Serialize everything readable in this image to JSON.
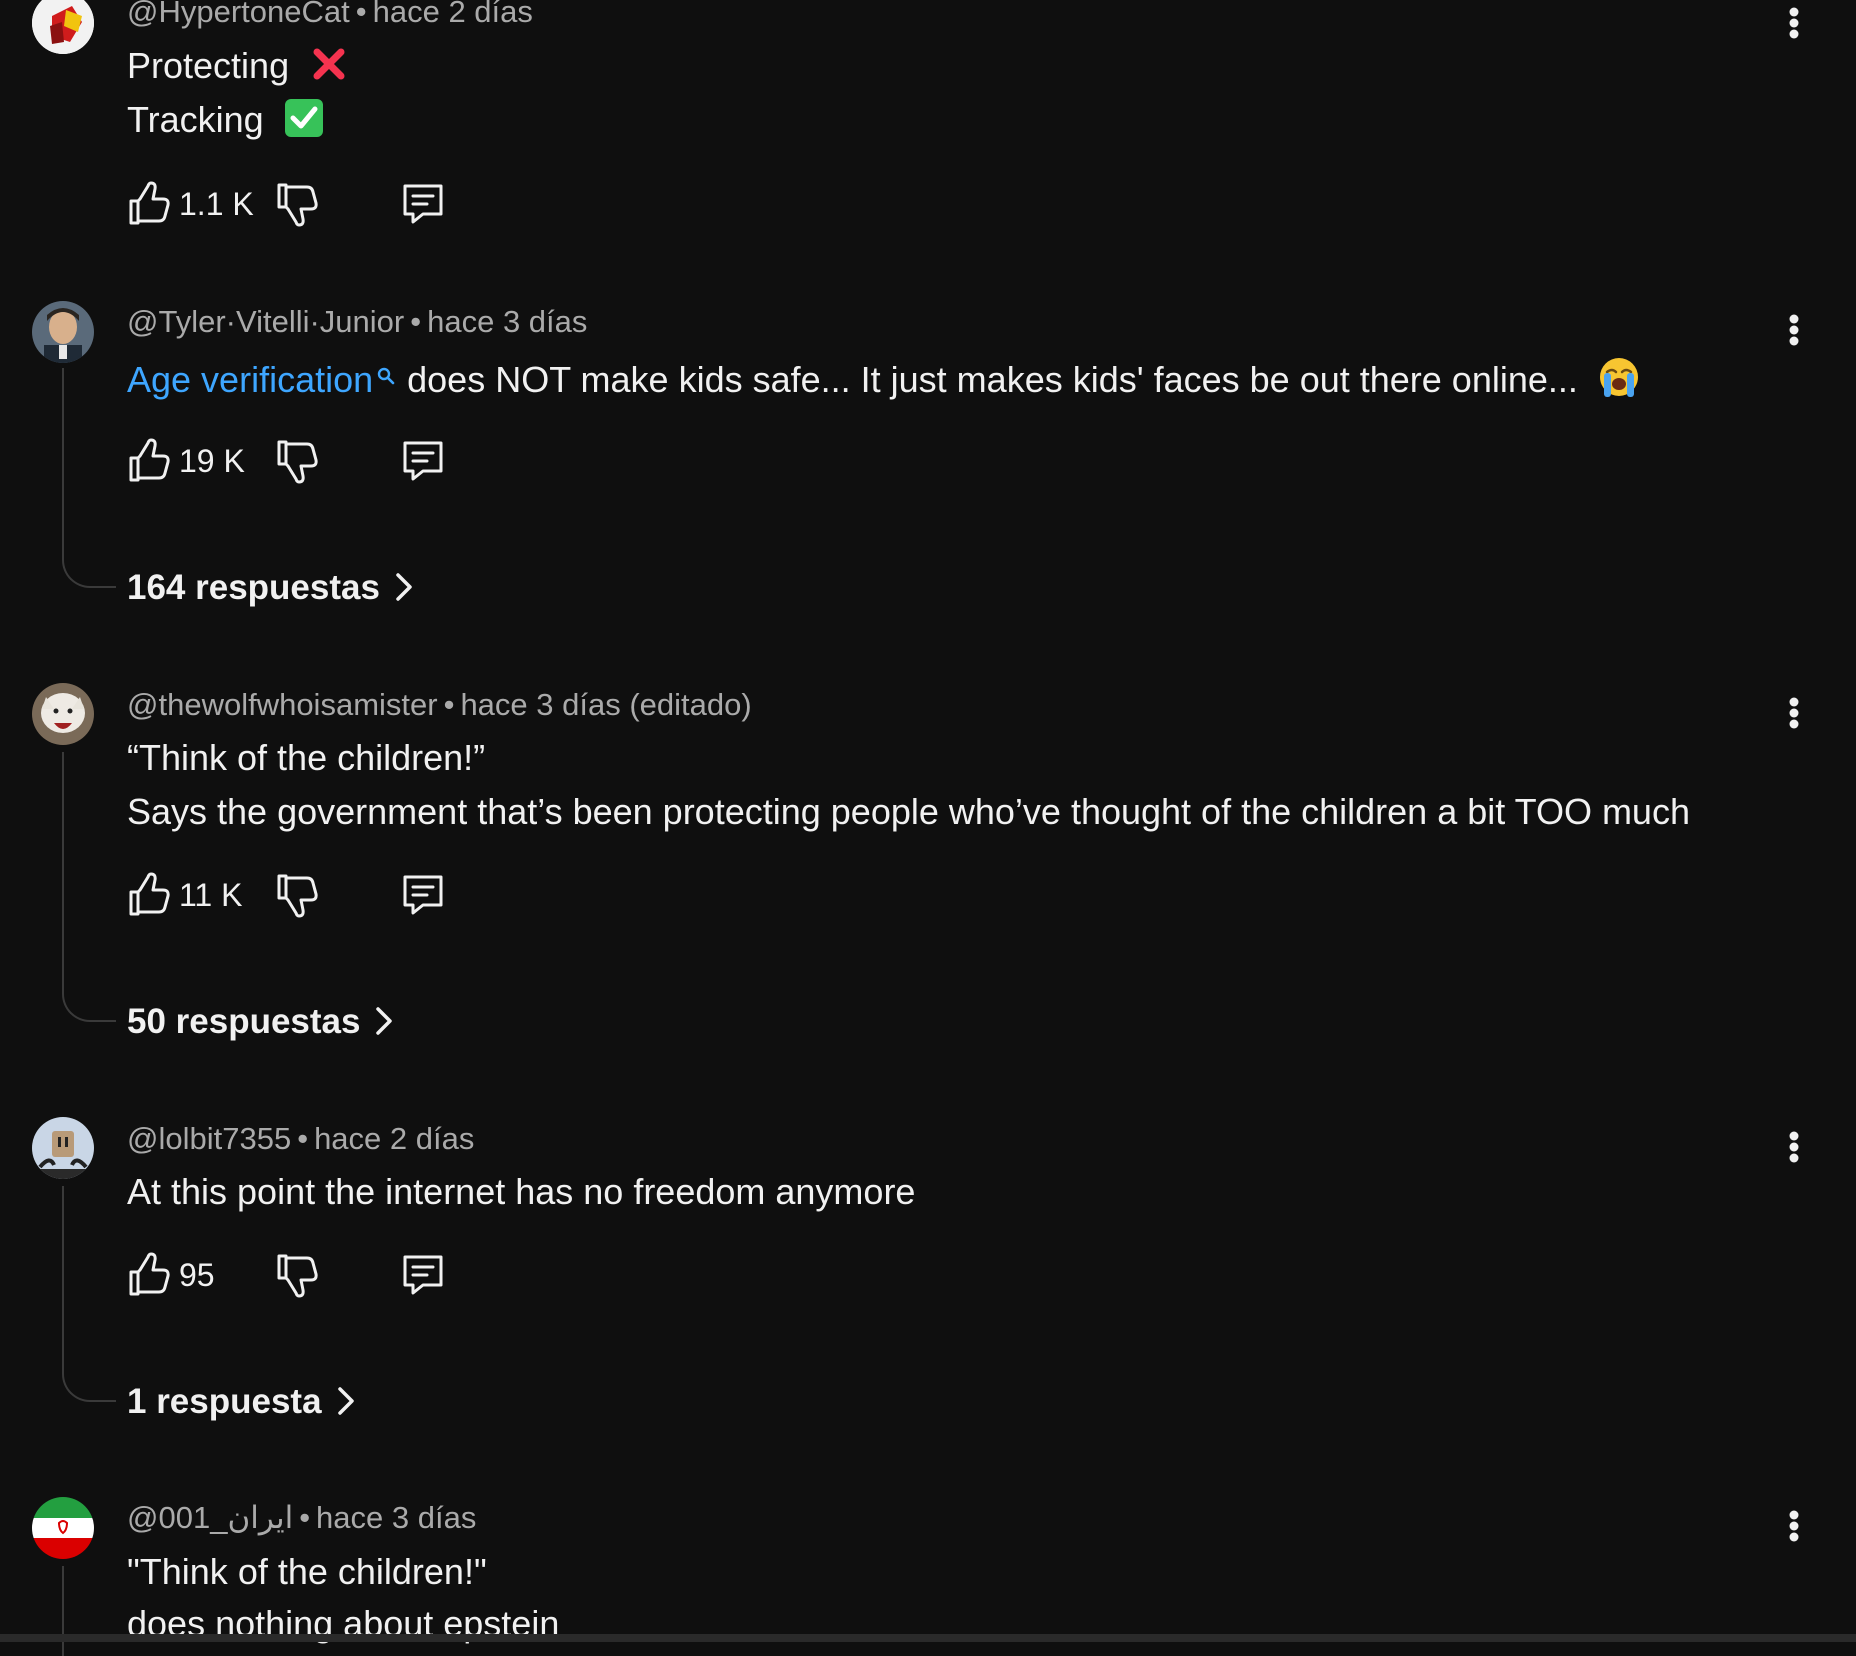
{
  "comments": [
    {
      "author": "@HypertoneCat",
      "time": "hace 2 días",
      "lines": [
        "Protecting",
        "Tracking"
      ],
      "line_emoji": [
        "cross-mark-emoji",
        "check-mark-button-emoji"
      ],
      "likes": "1.1 K",
      "replies": null
    },
    {
      "author": "@Tyler·Vitelli·Junior",
      "time": "hace 3 días",
      "link": "Age verification",
      "text": "does NOT make kids safe... It just makes kids' faces be out there online...",
      "emoji": "loudly-crying-face-emoji",
      "likes": "19 K",
      "replies": "164 respuestas"
    },
    {
      "author": "@thewolfwhoisamister",
      "time": "hace 3 días (editado)",
      "lines": [
        "“Think of the children!”",
        "Says the government that’s been protecting people who’ve thought of the children a bit TOO much"
      ],
      "likes": "11 K",
      "replies": "50 respuestas"
    },
    {
      "author": "@lolbit7355",
      "time": "hace 2 días",
      "lines": [
        "At this point the internet has no freedom anymore"
      ],
      "likes": "95",
      "replies": "1 respuesta"
    },
    {
      "author": "@ایران_001",
      "time": "hace 3 días",
      "lines": [
        "\"Think of the children!\"",
        "does nothing about epstein"
      ]
    }
  ],
  "separator": "•",
  "icons": {
    "like": "thumbs-up-icon",
    "dislike": "thumbs-down-icon",
    "reply": "comment-icon",
    "more": "more-vertical-icon",
    "search": "search-icon",
    "chevron": "chevron-right-icon"
  },
  "colors": {
    "background": "#0f0f0f",
    "text": "#f1f1f1",
    "secondary": "#aaaaaa",
    "link": "#3ea6ff",
    "thread": "#3a3a3a"
  }
}
